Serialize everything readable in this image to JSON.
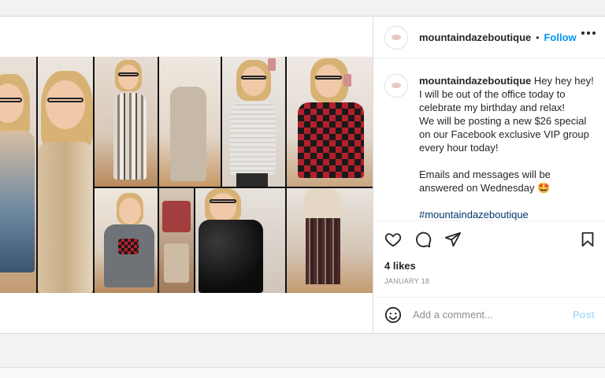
{
  "header": {
    "username": "mountaindazeboutique",
    "separator": "•",
    "follow_label": "Follow",
    "more_icon": "more-options-icon"
  },
  "caption": {
    "username": "mountaindazeboutique",
    "line1": "Hey hey hey! I will be out of the office today to celebrate my birthday and relax!",
    "line2": "We will be posting a new $26 special on our Facebook exclusive VIP group every hour today!",
    "line3": "Emails and messages will be answered on Wednesday 🤩",
    "hashtag": "#mountaindazeboutique"
  },
  "actions": {
    "like_icon": "heart-icon",
    "comment_icon": "comment-icon",
    "share_icon": "share-icon",
    "save_icon": "bookmark-icon",
    "likes": "4 likes",
    "date": "JANUARY 18"
  },
  "comment_box": {
    "placeholder": "Add a comment...",
    "post_label": "Post",
    "emoji_icon": "emoji-icon"
  },
  "colors": {
    "accent": "#0095f6",
    "post_disabled": "#b2dffc",
    "hashtag": "#00376b",
    "muted": "#8e8e8e"
  }
}
